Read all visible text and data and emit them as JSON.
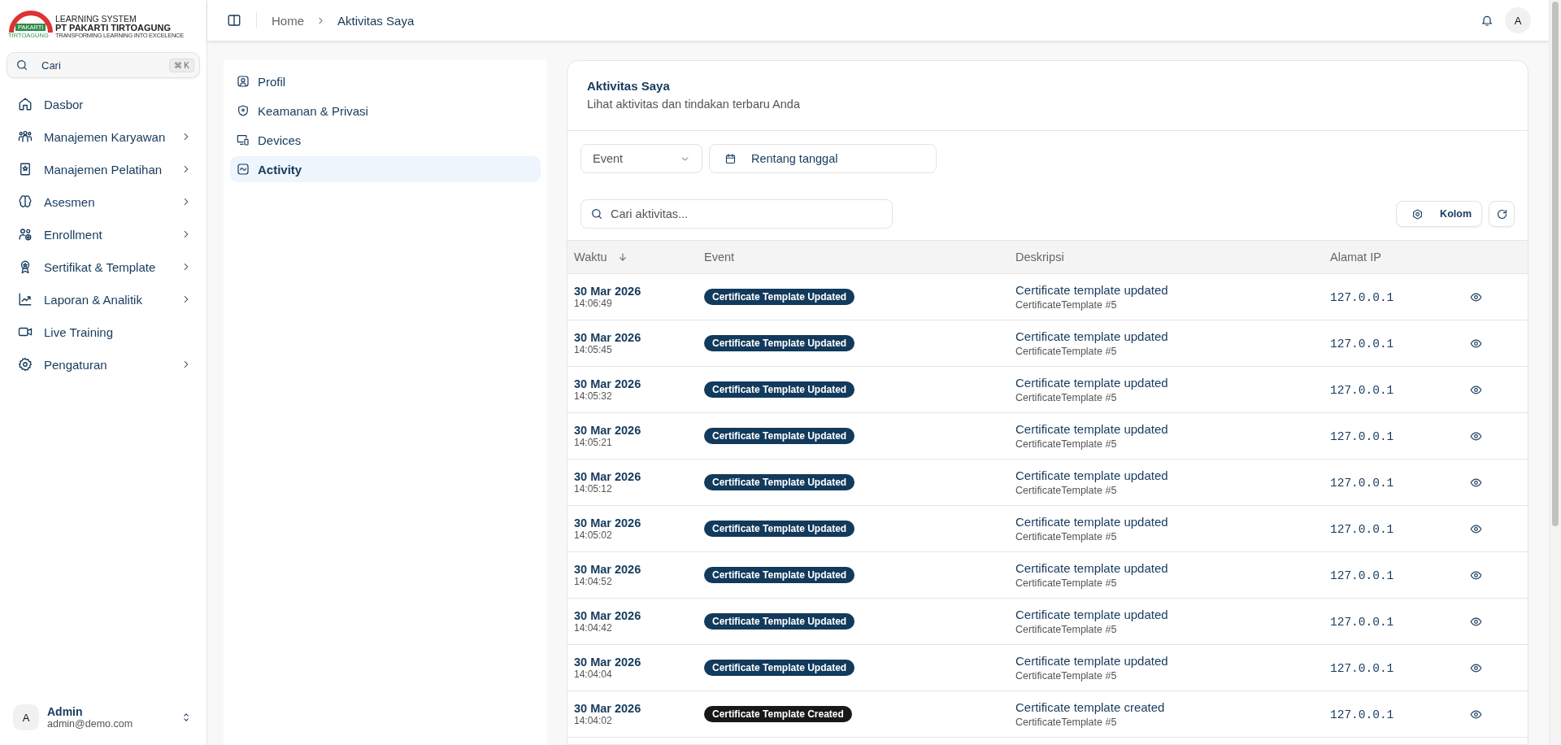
{
  "logo": {
    "pakarti": "PAKARTI",
    "tirtoagung": "TIRTOAGUNG",
    "line1": "LEARNING SYSTEM",
    "line2": "PT PAKARTI TIRTOAGUNG",
    "line3": "TRANSFORMING LEARNING INTO EXCELENCE"
  },
  "sidebar": {
    "search": {
      "placeholder": "Cari",
      "shortcut": "⌘ K"
    },
    "items": [
      {
        "label": "Dasbor",
        "expandable": false
      },
      {
        "label": "Manajemen Karyawan",
        "expandable": true
      },
      {
        "label": "Manajemen Pelatihan",
        "expandable": true
      },
      {
        "label": "Asesmen",
        "expandable": true
      },
      {
        "label": "Enrollment",
        "expandable": true
      },
      {
        "label": "Sertifikat & Template",
        "expandable": true
      },
      {
        "label": "Laporan & Analitik",
        "expandable": true
      },
      {
        "label": "Live Training",
        "expandable": false
      },
      {
        "label": "Pengaturan",
        "expandable": true
      }
    ],
    "user": {
      "avatar": "A",
      "name": "Admin",
      "email": "admin@demo.com"
    }
  },
  "topbar": {
    "breadcrumbs": [
      "Home",
      "Aktivitas Saya"
    ],
    "avatar": "A"
  },
  "settings_nav": [
    {
      "label": "Profil",
      "selected": false
    },
    {
      "label": "Keamanan & Privasi",
      "selected": false
    },
    {
      "label": "Devices",
      "selected": false
    },
    {
      "label": "Activity",
      "selected": true
    }
  ],
  "card": {
    "title": "Aktivitas Saya",
    "subtitle": "Lihat aktivitas dan tindakan terbaru Anda",
    "event_filter": "Event",
    "date_range": "Rentang tanggal",
    "search": {
      "placeholder": "Cari aktivitas..."
    },
    "columns_button": "Kolom",
    "table": {
      "columns": [
        "Waktu",
        "Event",
        "Deskripsi",
        "Alamat IP"
      ],
      "rows": [
        {
          "date": "30 Mar 2026",
          "time": "14:06:49",
          "event": "Certificate Template Updated",
          "kind": "updated",
          "description": "Certificate template updated",
          "subject": "CertificateTemplate #5",
          "ip": "127.0.0.1"
        },
        {
          "date": "30 Mar 2026",
          "time": "14:05:45",
          "event": "Certificate Template Updated",
          "kind": "updated",
          "description": "Certificate template updated",
          "subject": "CertificateTemplate #5",
          "ip": "127.0.0.1"
        },
        {
          "date": "30 Mar 2026",
          "time": "14:05:32",
          "event": "Certificate Template Updated",
          "kind": "updated",
          "description": "Certificate template updated",
          "subject": "CertificateTemplate #5",
          "ip": "127.0.0.1"
        },
        {
          "date": "30 Mar 2026",
          "time": "14:05:21",
          "event": "Certificate Template Updated",
          "kind": "updated",
          "description": "Certificate template updated",
          "subject": "CertificateTemplate #5",
          "ip": "127.0.0.1"
        },
        {
          "date": "30 Mar 2026",
          "time": "14:05:12",
          "event": "Certificate Template Updated",
          "kind": "updated",
          "description": "Certificate template updated",
          "subject": "CertificateTemplate #5",
          "ip": "127.0.0.1"
        },
        {
          "date": "30 Mar 2026",
          "time": "14:05:02",
          "event": "Certificate Template Updated",
          "kind": "updated",
          "description": "Certificate template updated",
          "subject": "CertificateTemplate #5",
          "ip": "127.0.0.1"
        },
        {
          "date": "30 Mar 2026",
          "time": "14:04:52",
          "event": "Certificate Template Updated",
          "kind": "updated",
          "description": "Certificate template updated",
          "subject": "CertificateTemplate #5",
          "ip": "127.0.0.1"
        },
        {
          "date": "30 Mar 2026",
          "time": "14:04:42",
          "event": "Certificate Template Updated",
          "kind": "updated",
          "description": "Certificate template updated",
          "subject": "CertificateTemplate #5",
          "ip": "127.0.0.1"
        },
        {
          "date": "30 Mar 2026",
          "time": "14:04:04",
          "event": "Certificate Template Updated",
          "kind": "updated",
          "description": "Certificate template updated",
          "subject": "CertificateTemplate #5",
          "ip": "127.0.0.1"
        },
        {
          "date": "30 Mar 2026",
          "time": "14:04:02",
          "event": "Certificate Template Created",
          "kind": "created",
          "description": "Certificate template created",
          "subject": "CertificateTemplate #5",
          "ip": "127.0.0.1"
        }
      ]
    }
  }
}
